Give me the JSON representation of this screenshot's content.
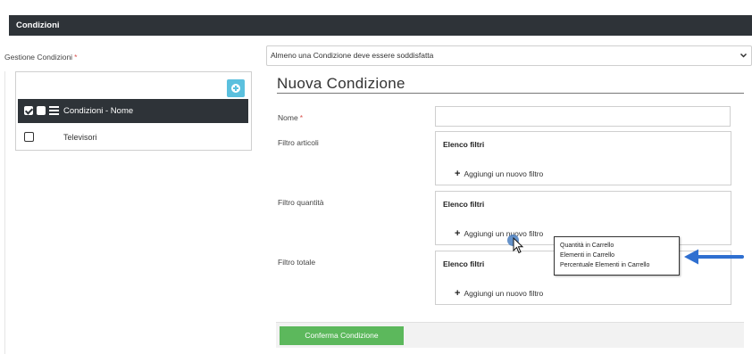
{
  "header": {
    "title": "Condizioni"
  },
  "left": {
    "label": "Gestione Condizioni",
    "required_marker": "*",
    "tree": {
      "header_title": "Condizioni - Nome",
      "items": [
        {
          "label": "Televisori",
          "checked": false
        }
      ]
    }
  },
  "main": {
    "select_value": "Almeno una Condizione deve essere soddisfatta",
    "title": "Nuova Condizione",
    "fields": {
      "nome_label": "Nome",
      "nome_required": "*",
      "nome_value": "",
      "filtro_articoli_label": "Filtro articoli",
      "filtro_quantita_label": "Filtro quantità",
      "filtro_totale_label": "Filtro totale"
    },
    "filter_boxes": [
      {
        "title": "Elenco filtri",
        "add_label": "Aggiungi un nuovo filtro"
      },
      {
        "title": "Elenco filtri",
        "add_label": "Aggiungi un nuovo filtro"
      },
      {
        "title": "Elenco filtri",
        "add_label": "Aggiungi un nuovo filtro"
      }
    ],
    "confirm_label": "Conferma Condizione"
  },
  "dropdown": {
    "options": [
      "Quantità in Carrello",
      "Elementi in Carrello",
      "Percentuale Elementi in Carrello"
    ]
  },
  "colors": {
    "dark_bar": "#2e3338",
    "accent_add": "#5bc0de",
    "confirm_green": "#5cb85c",
    "annotation_blue": "#2f6fd0",
    "required_red": "#d9534f"
  },
  "icons": {
    "add": "plus-circle-icon",
    "list": "list-icon",
    "select_chevron": "chevron-down-icon",
    "filter_add": "plus-icon",
    "cursor": "mouse-pointer-icon",
    "annotation": "arrow-left-icon"
  }
}
